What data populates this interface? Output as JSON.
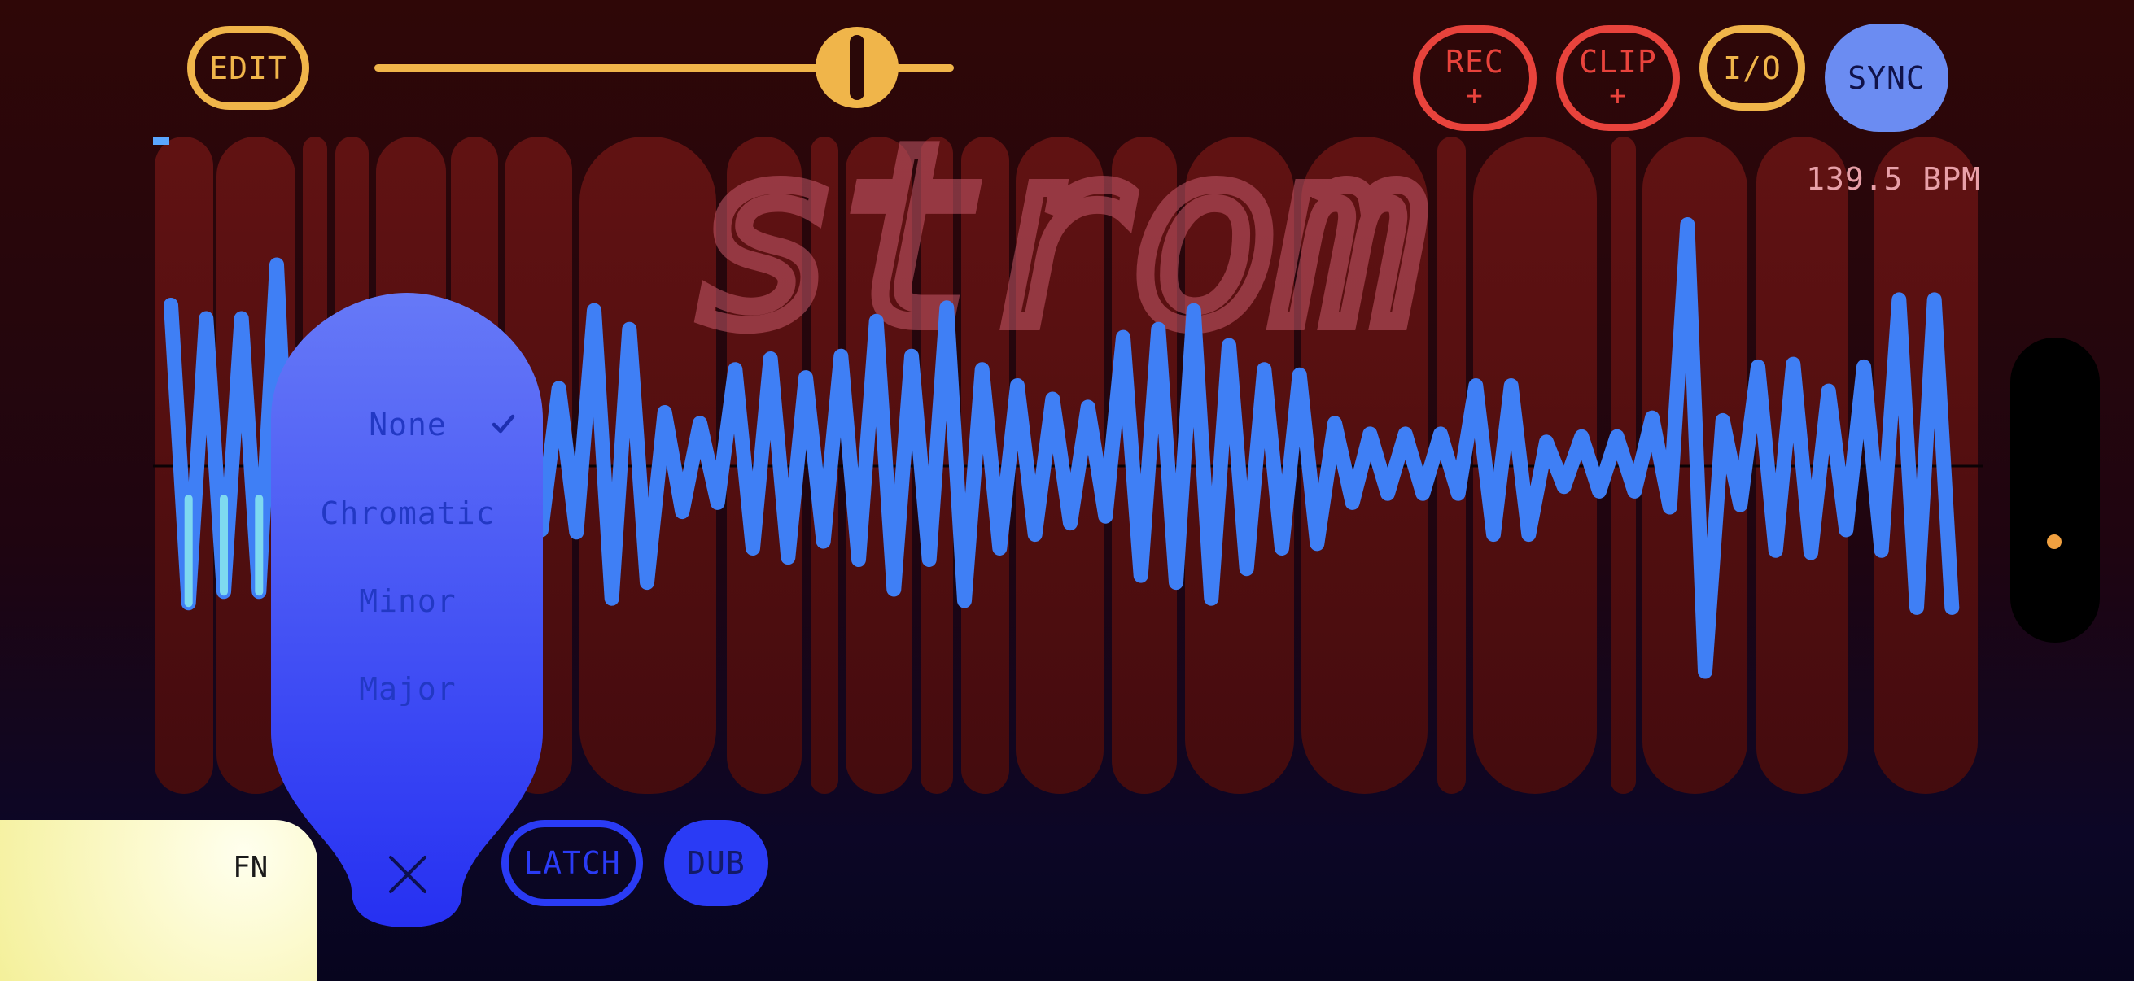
{
  "buttons": {
    "edit": "EDIT",
    "rec": "REC",
    "rec_sub": "+",
    "clip": "CLIP",
    "clip_sub": "+",
    "io": "I/O",
    "sync": "SYNC",
    "latch": "LATCH",
    "dub": "DUB",
    "fn": "FN"
  },
  "tempo": {
    "bpm_label": "139.5 BPM"
  },
  "logo": {
    "text": "strom"
  },
  "scale_menu": {
    "items": [
      "None",
      "Chromatic",
      "Minor",
      "Major"
    ],
    "selected": "None"
  },
  "colors": {
    "gold": "#f0b54a",
    "red": "#e8433c",
    "sync_blue": "#6b8cf2",
    "deep_blue": "#2a3bf5",
    "wave_blue": "#3f7ff5",
    "cyan": "#8ff0ef"
  },
  "icons": {
    "check": "check-icon",
    "close": "close-icon"
  },
  "waveform": {
    "levels": [
      0.6,
      0.55,
      0.55,
      0.75,
      0.28,
      0.28,
      0.27,
      0.28,
      0.3,
      0.28,
      0.28,
      0.29,
      0.58,
      0.51,
      0.2,
      0.16,
      0.36,
      0.4,
      0.33,
      0.41,
      0.54,
      0.41,
      0.59,
      0.36,
      0.3,
      0.25,
      0.22,
      0.48,
      0.51,
      0.58,
      0.45,
      0.36,
      0.34,
      0.16,
      0.12,
      0.12,
      0.12,
      0.3,
      0.3,
      0.09,
      0.11,
      0.11,
      0.18,
      0.9,
      0.17,
      0.37,
      0.38,
      0.28,
      0.37,
      0.62,
      0.62
    ],
    "scrub_levels": [
      0.6,
      0.55,
      0.55,
      0.75
    ],
    "columns": [
      [
        190,
        262
      ],
      [
        266,
        363
      ],
      [
        372,
        402
      ],
      [
        412,
        453
      ],
      [
        462,
        548
      ],
      [
        554,
        612
      ],
      [
        620,
        703
      ],
      [
        712,
        880
      ],
      [
        893,
        985
      ],
      [
        996,
        1030
      ],
      [
        1039,
        1121
      ],
      [
        1131,
        1171
      ],
      [
        1181,
        1240
      ],
      [
        1248,
        1356
      ],
      [
        1366,
        1446
      ],
      [
        1456,
        1590
      ],
      [
        1599,
        1754
      ],
      [
        1766,
        1801
      ],
      [
        1810,
        1962
      ],
      [
        1979,
        2010
      ],
      [
        2018,
        2147
      ],
      [
        2158,
        2270
      ],
      [
        2302,
        2430
      ]
    ]
  }
}
